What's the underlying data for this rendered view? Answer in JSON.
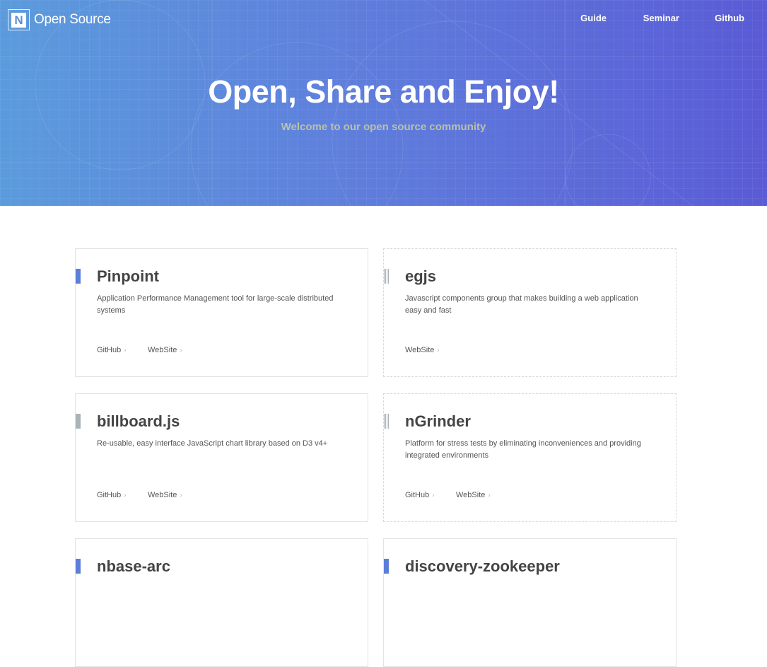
{
  "header": {
    "logo_letter": "N",
    "logo_text": "Open Source",
    "nav": [
      {
        "label": "Guide"
      },
      {
        "label": "Seminar"
      },
      {
        "label": "Github"
      }
    ]
  },
  "hero": {
    "title": "Open, Share and Enjoy!",
    "subtitle": "Welcome to our open source community"
  },
  "projects": [
    {
      "name": "Pinpoint",
      "description": "Application Performance Management tool for large-scale distributed systems",
      "links": [
        "GitHub",
        "WebSite"
      ],
      "chevron": "›"
    },
    {
      "name": "egjs",
      "description": "Javascript components group that makes building a web application easy and fast",
      "links": [
        "WebSite"
      ],
      "chevron": "›"
    },
    {
      "name": "billboard.js",
      "description": "Re-usable, easy interface JavaScript chart library based on D3 v4+",
      "links": [
        "GitHub",
        "WebSite"
      ],
      "chevron": "›"
    },
    {
      "name": "nGrinder",
      "description": "Platform for stress tests by eliminating inconveniences and providing integrated environments",
      "links": [
        "GitHub",
        "WebSite"
      ],
      "chevron": "›"
    },
    {
      "name": "nbase-arc",
      "description": "",
      "links": [],
      "chevron": "›"
    },
    {
      "name": "discovery-zookeeper",
      "description": "",
      "links": [],
      "chevron": "›"
    }
  ],
  "colors": {
    "hero_start": "#5b9bdc",
    "hero_end": "#5a5bd6",
    "accent_blue": "#5b7fd8",
    "accent_gray": "#aab4b8",
    "title_text": "#444444"
  }
}
